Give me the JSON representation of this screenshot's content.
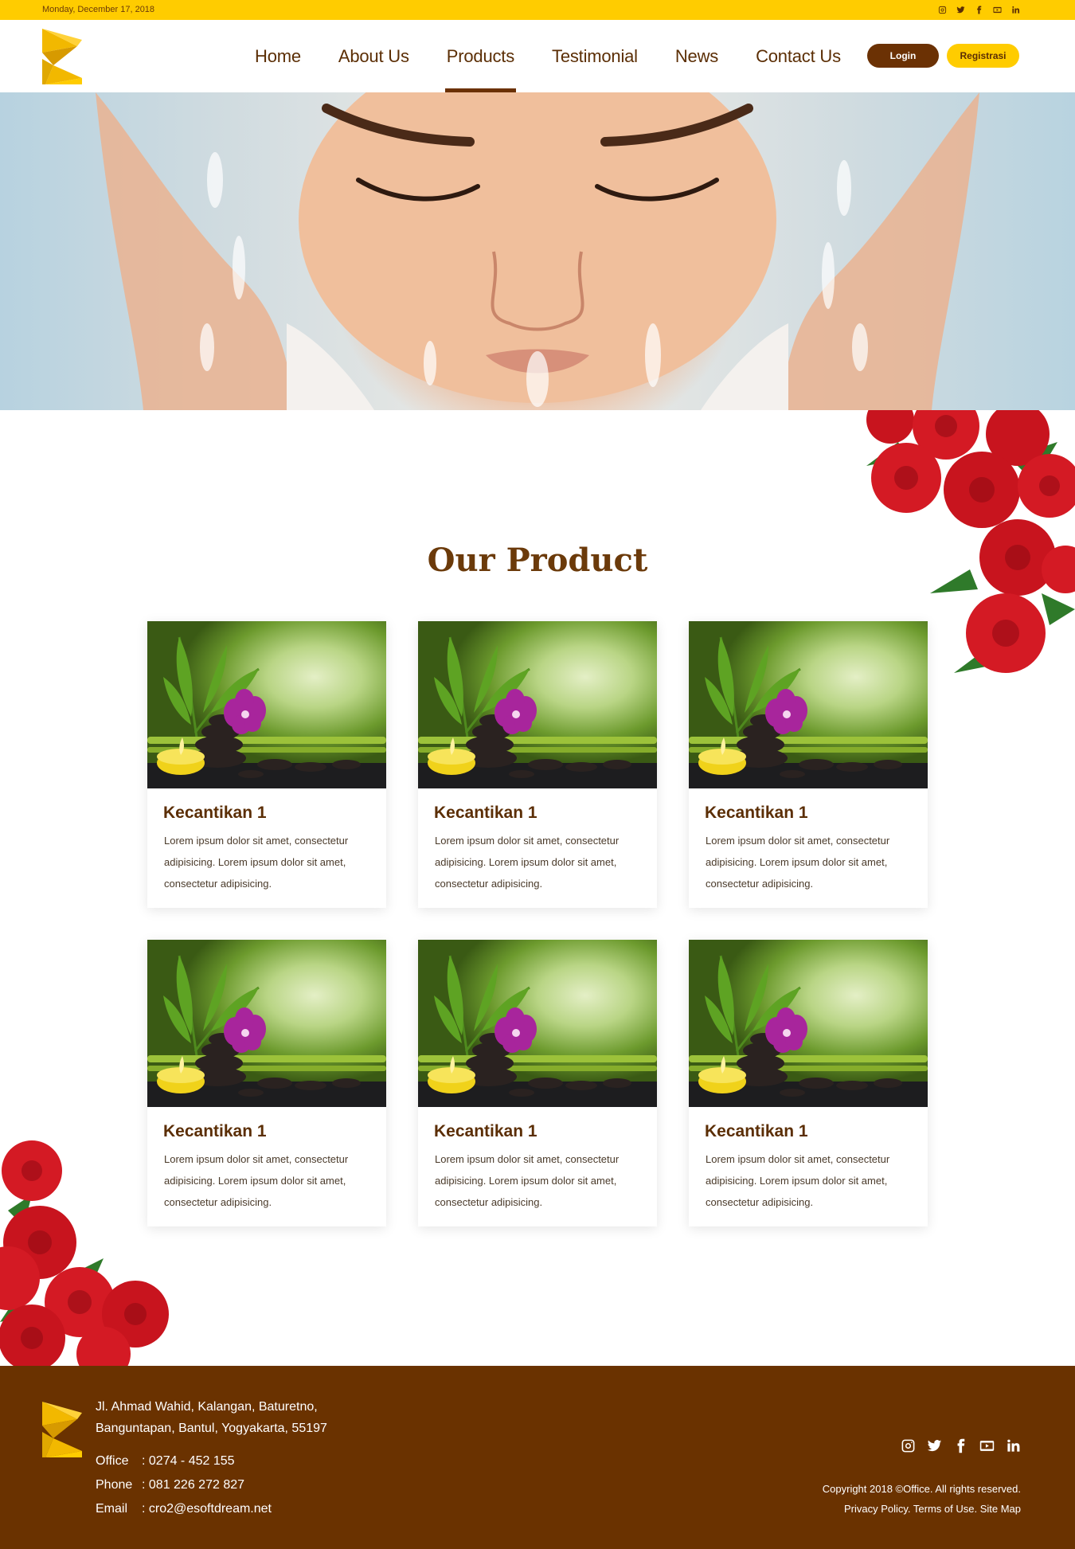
{
  "topbar": {
    "date": "Monday, December 17, 2018",
    "socials": [
      "instagram-icon",
      "twitter-icon",
      "facebook-icon",
      "youtube-icon",
      "linkedin-icon"
    ]
  },
  "header": {
    "nav": [
      "Home",
      "About Us",
      "Products",
      "Testimonial",
      "News",
      "Contact Us"
    ],
    "active_nav": "Products",
    "login_label": "Login",
    "register_label": "Registrasi"
  },
  "section": {
    "title": "Our Product"
  },
  "products": [
    {
      "title": "Kecantikan 1",
      "desc": "Lorem ipsum dolor sit amet, consectetur adipisicing. Lorem ipsum dolor sit amet, consectetur adipisicing."
    },
    {
      "title": "Kecantikan 1",
      "desc": "Lorem ipsum dolor sit amet, consectetur adipisicing. Lorem ipsum dolor sit amet, consectetur adipisicing."
    },
    {
      "title": "Kecantikan 1",
      "desc": "Lorem ipsum dolor sit amet, consectetur adipisicing. Lorem ipsum dolor sit amet, consectetur adipisicing."
    },
    {
      "title": "Kecantikan 1",
      "desc": "Lorem ipsum dolor sit amet, consectetur adipisicing. Lorem ipsum dolor sit amet, consectetur adipisicing."
    },
    {
      "title": "Kecantikan 1",
      "desc": "Lorem ipsum dolor sit amet, consectetur adipisicing. Lorem ipsum dolor sit amet, consectetur adipisicing."
    },
    {
      "title": "Kecantikan 1",
      "desc": "Lorem ipsum dolor sit amet, consectetur adipisicing. Lorem ipsum dolor sit amet, consectetur adipisicing."
    }
  ],
  "footer": {
    "address_line1": "Jl. Ahmad Wahid, Kalangan, Baturetno,",
    "address_line2": "Banguntapan, Bantul, Yogyakarta, 55197",
    "office_label": "Office",
    "office_value": ": 0274 - 452 155",
    "phone_label": "Phone",
    "phone_value": ": 081 226 272 827",
    "email_label": "Email",
    "email_value": ": cro2@esoftdream.net",
    "copyright": "Copyright 2018 ©Office. All rights reserved.",
    "links": "Privacy Policy. Terms of Use. Site Map"
  },
  "colors": {
    "brand_yellow": "#ffcc00",
    "brand_brown": "#6a3200"
  }
}
